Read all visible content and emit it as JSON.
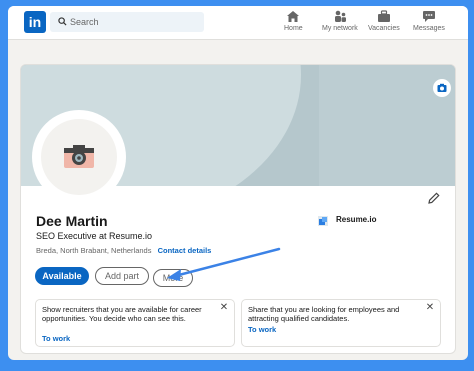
{
  "nav": {
    "logo": "in",
    "search_placeholder": "Search",
    "items": [
      {
        "label": "Home",
        "icon": "home-icon"
      },
      {
        "label": "My network",
        "icon": "network-icon"
      },
      {
        "label": "Vacancies",
        "icon": "briefcase-icon"
      },
      {
        "label": "Messages",
        "icon": "message-icon"
      }
    ]
  },
  "profile": {
    "name": "Dee Martin",
    "headline": "SEO Executive at Resume.io",
    "location": "Breda, North Brabant, Netherlands",
    "contact_link": "Contact details",
    "company": "Resume.io",
    "buttons": {
      "available": "Available",
      "add_part": "Add part",
      "more": "More"
    }
  },
  "cards": [
    {
      "text": "Show recruiters that you are available for career opportunities. You decide who can see this.",
      "link": "To work"
    },
    {
      "text": "Share that you are looking for employees and attracting qualified candidates.",
      "link": "To work"
    }
  ],
  "colors": {
    "brand": "#0a66c2",
    "frame_bg": "#3d8ff0",
    "arrow": "#3b82e6"
  }
}
